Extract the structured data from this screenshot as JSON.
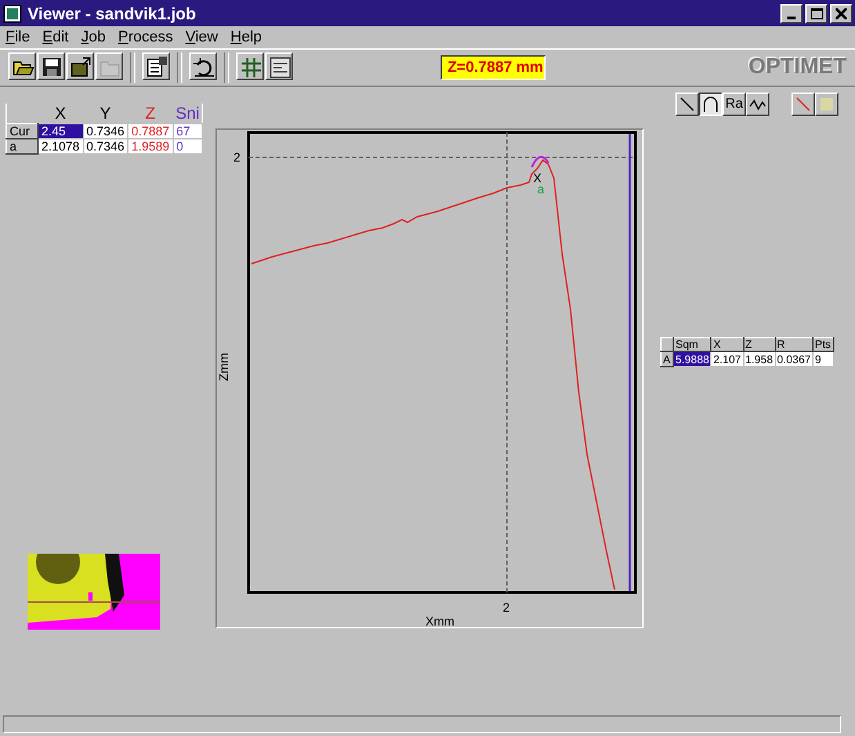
{
  "window": {
    "title": "Viewer - sandvik1.job"
  },
  "menu": [
    {
      "label": "File"
    },
    {
      "label": "Edit"
    },
    {
      "label": "Job"
    },
    {
      "label": "Process"
    },
    {
      "label": "View"
    },
    {
      "label": "Help"
    }
  ],
  "toolbar": [
    {
      "kind": "open",
      "disabled": false
    },
    {
      "kind": "save",
      "disabled": false
    },
    {
      "kind": "export",
      "disabled": false
    },
    {
      "kind": "folder",
      "disabled": true
    },
    {
      "kind": "gap"
    },
    {
      "kind": "properties",
      "disabled": false
    },
    {
      "kind": "gap"
    },
    {
      "kind": "undo",
      "disabled": false
    },
    {
      "kind": "gap"
    },
    {
      "kind": "grid",
      "disabled": false
    },
    {
      "kind": "image",
      "disabled": false
    }
  ],
  "readout": "Z=0.7887 mm",
  "logo": "OPTIMET",
  "point_table": {
    "columns": [
      {
        "label": "X",
        "color": "#000000"
      },
      {
        "label": "Y",
        "color": "#000000"
      },
      {
        "label": "Z",
        "color": "#e02020"
      },
      {
        "label": "Sni",
        "color": "#6030c0"
      }
    ],
    "rows": [
      {
        "label": "Cur",
        "cells": [
          {
            "text": "2.45",
            "selected": true
          },
          {
            "text": "0.7346",
            "selected": false
          },
          {
            "text": "0.7887",
            "selected": false
          },
          {
            "text": "67",
            "selected": false
          }
        ]
      },
      {
        "label": "a",
        "cells": [
          {
            "text": "2.1078",
            "selected": false
          },
          {
            "text": "0.7346",
            "selected": false
          },
          {
            "text": "1.9589",
            "selected": false
          },
          {
            "text": "0",
            "selected": false
          }
        ]
      }
    ]
  },
  "tool_buttons": [
    {
      "kind": "line",
      "selected": false
    },
    {
      "kind": "arc",
      "selected": true
    },
    {
      "kind": "text",
      "label": "Ra",
      "selected": false
    },
    {
      "kind": "wave",
      "selected": false
    }
  ],
  "style_buttons": [
    {
      "kind": "slash"
    },
    {
      "kind": "swatch"
    }
  ],
  "plot": {
    "xlabel": "Xmm",
    "ylabel": "Zmm",
    "xtick": "2",
    "ytick": "2",
    "marker": "X",
    "marker_label": "a"
  },
  "fit_table": {
    "columns": [
      "Sqm",
      "X",
      "Z",
      "R",
      "Pts"
    ],
    "rows": [
      {
        "label": "A",
        "cells": [
          {
            "text": "5.9888",
            "selected": true
          },
          {
            "text": "2.107",
            "selected": false
          },
          {
            "text": "1.958",
            "selected": false
          },
          {
            "text": "0.0367",
            "selected": false
          },
          {
            "text": "9",
            "selected": false
          }
        ]
      }
    ]
  }
}
